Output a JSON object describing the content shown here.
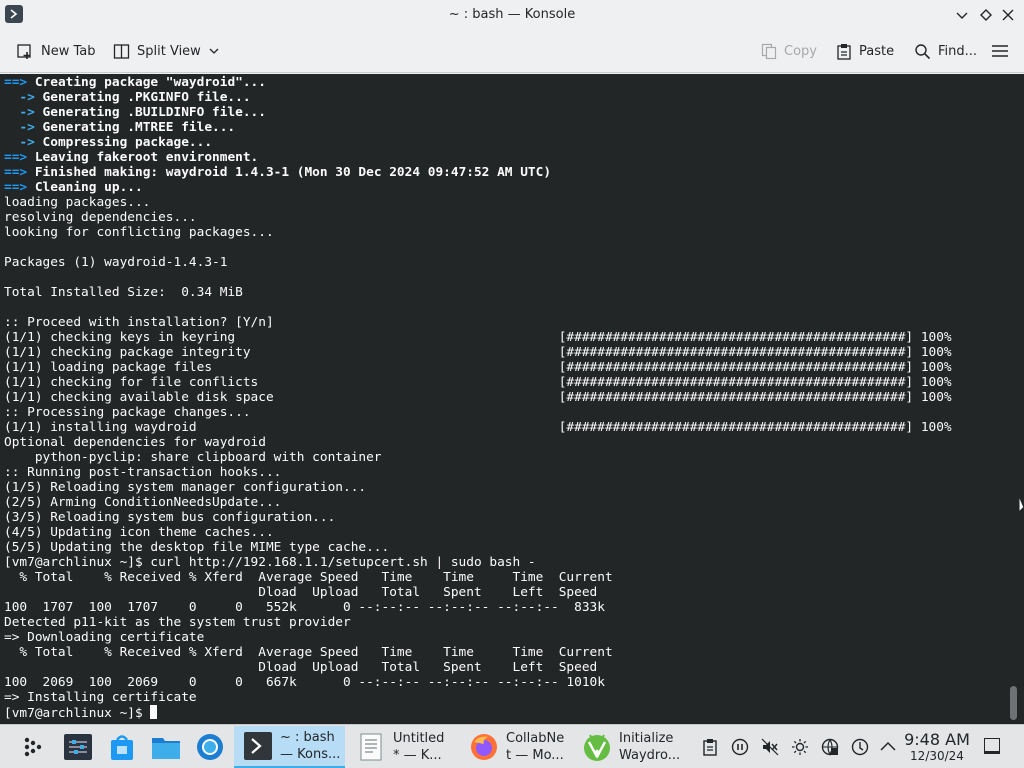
{
  "window": {
    "title": "~ : bash — Konsole"
  },
  "toolbar": {
    "new_tab": "New Tab",
    "split_view": "Split View",
    "copy": "Copy",
    "paste": "Paste",
    "find": "Find..."
  },
  "terminal": {
    "lines": [
      [
        [
          "c-blue",
          "==> "
        ],
        [
          "c-bold",
          "Creating package \"waydroid\"..."
        ]
      ],
      [
        [
          "c-cyan",
          "  -> "
        ],
        [
          "c-bold",
          "Generating .PKGINFO file..."
        ]
      ],
      [
        [
          "c-cyan",
          "  -> "
        ],
        [
          "c-bold",
          "Generating .BUILDINFO file..."
        ]
      ],
      [
        [
          "c-cyan",
          "  -> "
        ],
        [
          "c-bold",
          "Generating .MTREE file..."
        ]
      ],
      [
        [
          "c-cyan",
          "  -> "
        ],
        [
          "c-bold",
          "Compressing package..."
        ]
      ],
      [
        [
          "c-blue",
          "==> "
        ],
        [
          "c-bold",
          "Leaving fakeroot environment."
        ]
      ],
      [
        [
          "c-blue",
          "==> "
        ],
        [
          "c-bold",
          "Finished making: waydroid 1.4.3-1 (Mon 30 Dec 2024 09:47:52 AM UTC)"
        ]
      ],
      [
        [
          "c-blue",
          "==> "
        ],
        [
          "c-bold",
          "Cleaning up..."
        ]
      ],
      [
        [
          "c-norm",
          "loading packages..."
        ]
      ],
      [
        [
          "c-norm",
          "resolving dependencies..."
        ]
      ],
      [
        [
          "c-norm",
          "looking for conflicting packages..."
        ]
      ],
      [
        [
          "c-norm",
          ""
        ]
      ],
      [
        [
          "c-norm",
          "Packages (1) waydroid-1.4.3-1"
        ]
      ],
      [
        [
          "c-norm",
          ""
        ]
      ],
      [
        [
          "c-norm",
          "Total Installed Size:  0.34 MiB"
        ]
      ],
      [
        [
          "c-norm",
          ""
        ]
      ],
      [
        [
          "c-norm",
          ":: Proceed with installation? [Y/n]"
        ]
      ],
      [
        [
          "c-norm",
          "(1/1) checking keys in keyring                                          [############################################] 100%"
        ]
      ],
      [
        [
          "c-norm",
          "(1/1) checking package integrity                                        [############################################] 100%"
        ]
      ],
      [
        [
          "c-norm",
          "(1/1) loading package files                                             [############################################] 100%"
        ]
      ],
      [
        [
          "c-norm",
          "(1/1) checking for file conflicts                                       [############################################] 100%"
        ]
      ],
      [
        [
          "c-norm",
          "(1/1) checking available disk space                                     [############################################] 100%"
        ]
      ],
      [
        [
          "c-norm",
          ":: Processing package changes..."
        ]
      ],
      [
        [
          "c-norm",
          "(1/1) installing waydroid                                               [############################################] 100%"
        ]
      ],
      [
        [
          "c-norm",
          "Optional dependencies for waydroid"
        ]
      ],
      [
        [
          "c-norm",
          "    python-pyclip: share clipboard with container"
        ]
      ],
      [
        [
          "c-norm",
          ":: Running post-transaction hooks..."
        ]
      ],
      [
        [
          "c-norm",
          "(1/5) Reloading system manager configuration..."
        ]
      ],
      [
        [
          "c-norm",
          "(2/5) Arming ConditionNeedsUpdate..."
        ]
      ],
      [
        [
          "c-norm",
          "(3/5) Reloading system bus configuration..."
        ]
      ],
      [
        [
          "c-norm",
          "(4/5) Updating icon theme caches..."
        ]
      ],
      [
        [
          "c-norm",
          "(5/5) Updating the desktop file MIME type cache..."
        ]
      ],
      [
        [
          "c-norm",
          "[vm7@archlinux ~]$ curl http://192.168.1.1/setupcert.sh | sudo bash -"
        ]
      ],
      [
        [
          "c-norm",
          "  % Total    % Received % Xferd  Average Speed   Time    Time     Time  Current"
        ]
      ],
      [
        [
          "c-norm",
          "                                 Dload  Upload   Total   Spent    Left  Speed"
        ]
      ],
      [
        [
          "c-norm",
          "100  1707  100  1707    0     0   552k      0 --:--:-- --:--:-- --:--:--  833k"
        ]
      ],
      [
        [
          "c-norm",
          "Detected p11-kit as the system trust provider"
        ]
      ],
      [
        [
          "c-norm",
          "=> Downloading certificate"
        ]
      ],
      [
        [
          "c-norm",
          "  % Total    % Received % Xferd  Average Speed   Time    Time     Time  Current"
        ]
      ],
      [
        [
          "c-norm",
          "                                 Dload  Upload   Total   Spent    Left  Speed"
        ]
      ],
      [
        [
          "c-norm",
          "100  2069  100  2069    0     0   667k      0 --:--:-- --:--:-- --:--:-- 1010k"
        ]
      ],
      [
        [
          "c-norm",
          "=> Installing certificate"
        ]
      ]
    ],
    "prompt": "[vm7@archlinux ~]$ "
  },
  "taskbar": {
    "tasks": [
      {
        "label": "~ : bash\n— Kons...",
        "active": true
      },
      {
        "label": "Untitled\n* — K...",
        "active": false
      },
      {
        "label": "CollabNe\nt — Mo...",
        "active": false
      },
      {
        "label": "Initialize\nWaydro...",
        "active": false
      }
    ],
    "clock": {
      "time": "9:48 AM",
      "date": "12/30/24"
    }
  },
  "colors": {
    "terminal_bg": "#232627",
    "accent": "#3daee9",
    "active_task": "#b7dcf5"
  }
}
